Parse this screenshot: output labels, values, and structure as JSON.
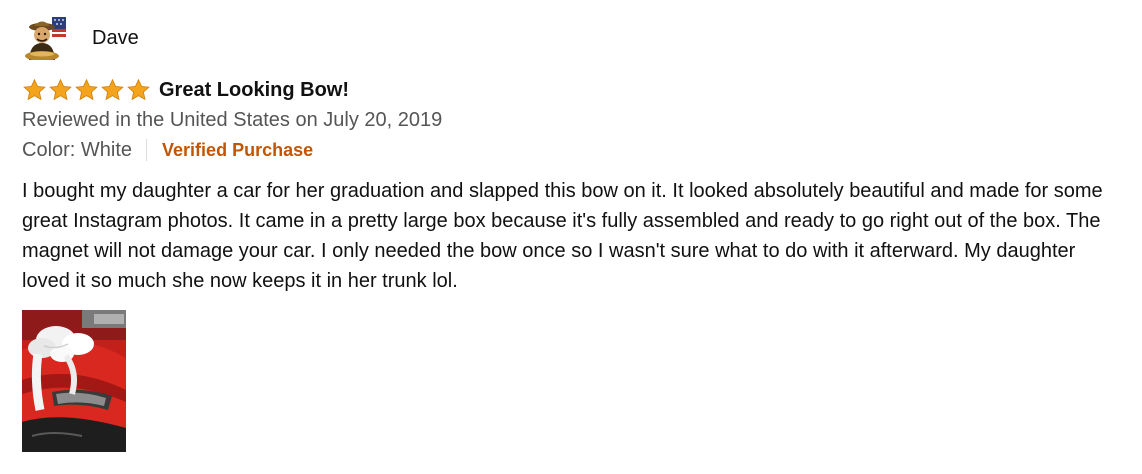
{
  "reviewer": {
    "name": "Dave",
    "avatar_icon": "reviewer-avatar-icon"
  },
  "rating": {
    "stars": 5,
    "max": 5,
    "star_color": "#f4a41c",
    "icon": "star-icon"
  },
  "review": {
    "title": "Great Looking Bow!",
    "date_line": "Reviewed in the United States on July 20, 2019",
    "variant": "Color: White",
    "verified_label": "Verified Purchase",
    "body": "I bought my daughter a car for her graduation and slapped this bow on it. It looked absolutely beautiful and made for some great Instagram photos. It came in a pretty large box because it's fully assembled and ready to go right out of the box. The magnet will not damage your car. I only needed the bow once so I wasn't sure what to do with it afterward. My daughter loved it so much she now keeps it in her trunk lol."
  },
  "colors": {
    "verified": "#c45500",
    "meta_text": "#555555",
    "body_text": "#111111"
  },
  "images": [
    {
      "icon": "car-photo-thumbnail"
    }
  ]
}
